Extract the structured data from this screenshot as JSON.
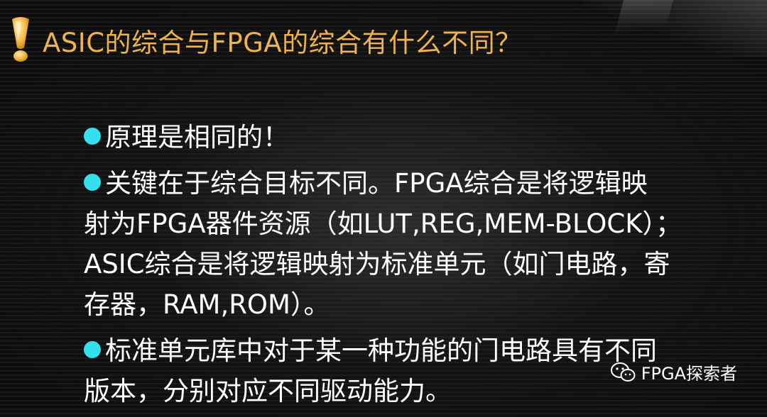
{
  "title": "ASIC的综合与FPGA的综合有什么不同？",
  "bullets": [
    {
      "lines": [
        "原理是相同的！"
      ]
    },
    {
      "lines": [
        "关键在于综合目标不同。FPGA综合是将逻辑映",
        "射为FPGA器件资源（如LUT,REG,MEM-BLOCK）；",
        "ASIC综合是将逻辑映射为标准单元（如门电路，寄",
        "存器，RAM,ROM）。"
      ]
    },
    {
      "lines": [
        "标准单元库中对于某一种功能的门电路具有不同",
        "版本，分别对应不同驱动能力。"
      ]
    }
  ],
  "watermark": {
    "text": "FPGA探索者",
    "icon": "wechat-icon"
  },
  "title_icon": "exclamation-icon",
  "colors": {
    "title": "#f0b24a",
    "bullet_dot": "#33e0ec",
    "text": "#ffffff",
    "background": "#0d0d0d"
  }
}
